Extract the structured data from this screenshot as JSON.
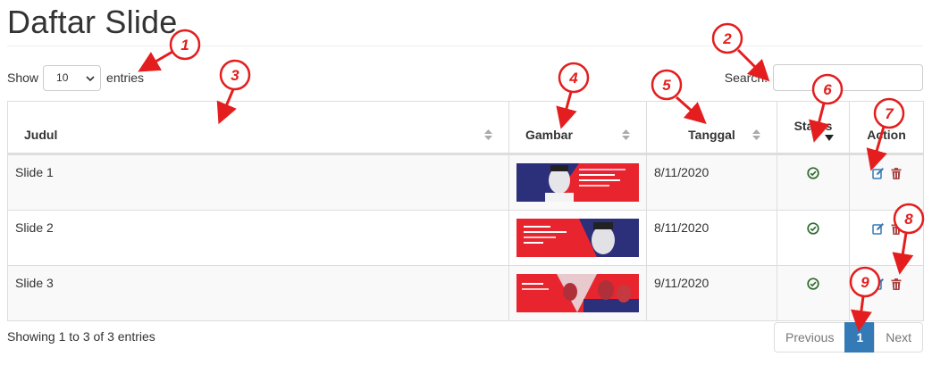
{
  "page": {
    "title": "Daftar Slide"
  },
  "length": {
    "show_label": "Show",
    "value": "10",
    "entries_label": "entries"
  },
  "search": {
    "label": "Search:",
    "value": "",
    "placeholder": ""
  },
  "table": {
    "columns": [
      "Judul",
      "Gambar",
      "Tanggal",
      "Status",
      "Action"
    ],
    "rows": [
      {
        "judul": "Slide 1",
        "tanggal": "8/11/2020",
        "status": "active"
      },
      {
        "judul": "Slide 2",
        "tanggal": "8/11/2020",
        "status": "active"
      },
      {
        "judul": "Slide 3",
        "tanggal": "9/11/2020",
        "status": "active"
      }
    ]
  },
  "footer": {
    "info": "Showing 1 to 3 of 3 entries",
    "pagination": {
      "previous": "Previous",
      "current": "1",
      "next": "Next"
    }
  },
  "annotations": [
    "1",
    "2",
    "3",
    "4",
    "5",
    "6",
    "7",
    "8",
    "9"
  ],
  "colors": {
    "accent": "#337ab7",
    "annotation": "#e41e1e",
    "status_ok": "#3c763d",
    "delete": "#a94442",
    "edit": "#337ab7"
  },
  "icons": {
    "status": "check-circle-icon",
    "edit": "edit-icon",
    "delete": "trash-icon",
    "sort": "sort-icon"
  }
}
